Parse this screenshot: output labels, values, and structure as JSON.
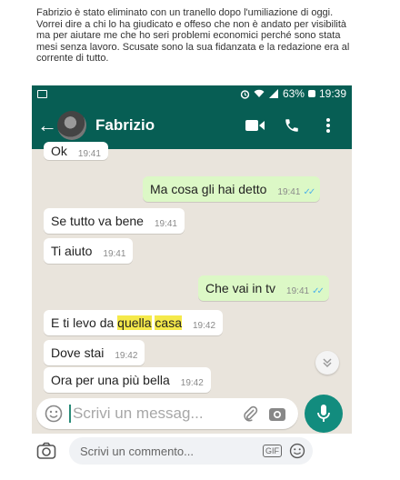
{
  "post": {
    "text": "Fabrizio è stato eliminato con un tranello dopo l'umiliazione di oggi.  Vorrei dire a chi lo ha giudicato e offeso che non è andato per visibilità ma per aiutare me che ho seri problemi economici perché sono stata mesi senza lavoro.  Scusate sono la sua fidanzata e la redazione era al corrente di tutto."
  },
  "status_bar": {
    "battery": "63%",
    "time": "19:39"
  },
  "chat_header": {
    "back_icon": "arrow-left-icon",
    "contact_name": "Fabrizio",
    "video_icon": "video-call-icon",
    "call_icon": "phone-icon",
    "menu_icon": "more-vertical-icon"
  },
  "messages": [
    {
      "side": "in",
      "text": "Ok",
      "time": "19:41"
    },
    {
      "side": "out",
      "text": "Ma cosa gli hai detto",
      "time": "19:41"
    },
    {
      "side": "in",
      "text": "Se tutto va bene",
      "time": "19:41"
    },
    {
      "side": "in",
      "text": "Ti aiuto",
      "time": "19:41"
    },
    {
      "side": "out",
      "text": "Che vai in tv",
      "time": "19:41"
    },
    {
      "side": "in",
      "text_parts": [
        "E ti levo da ",
        "quella",
        " ",
        "casa"
      ],
      "highlighted_words": [
        "quella",
        "casa"
      ],
      "time": "19:42"
    },
    {
      "side": "in",
      "text": "Dove stai",
      "time": "19:42"
    },
    {
      "side": "in",
      "text": "Ora per una più bella",
      "time": "19:42"
    }
  ],
  "composer": {
    "placeholder": "Scrivi un messag...",
    "emoji_icon": "emoji-icon",
    "attach_icon": "paperclip-icon",
    "camera_icon": "camera-icon",
    "mic_icon": "microphone-icon"
  },
  "comment_bar": {
    "placeholder": "Scrivi un commento...",
    "gif_label": "GIF",
    "camera_icon": "camera-icon",
    "emoji_icon": "smiley-icon"
  },
  "colors": {
    "header_green": "#075e54",
    "outgoing_bubble": "#dcf8c6",
    "incoming_bubble": "#ffffff",
    "highlight": "#f5e94a",
    "mic_button": "#128c7e",
    "read_ticks": "#4fb3e8"
  }
}
